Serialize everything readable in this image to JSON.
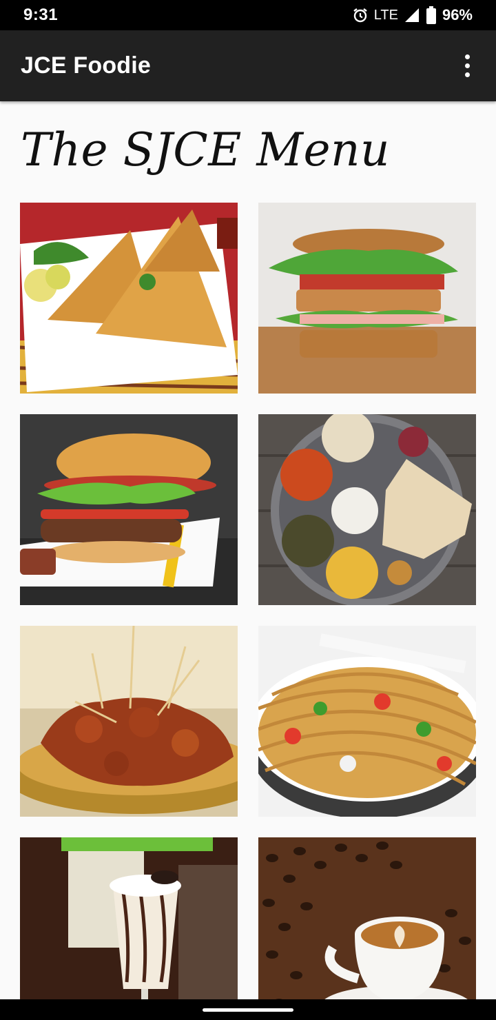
{
  "status_bar": {
    "time": "9:31",
    "network": "LTE",
    "battery": "96%",
    "icons": [
      "alarm-icon",
      "signal-icon",
      "battery-icon"
    ]
  },
  "app_bar": {
    "title": "JCE Foodie",
    "menu_icon": "more-vert-icon"
  },
  "menu": {
    "heading": "The SJCE Menu",
    "items": [
      {
        "image": "samosa"
      },
      {
        "image": "sandwich"
      },
      {
        "image": "burger"
      },
      {
        "image": "thali"
      },
      {
        "image": "gobi-manchurian"
      },
      {
        "image": "noodles"
      },
      {
        "image": "milkshake"
      },
      {
        "image": "coffee"
      }
    ]
  },
  "colors": {
    "app_bar": "#212121",
    "status_bar": "#000000",
    "background": "#fafafa"
  }
}
